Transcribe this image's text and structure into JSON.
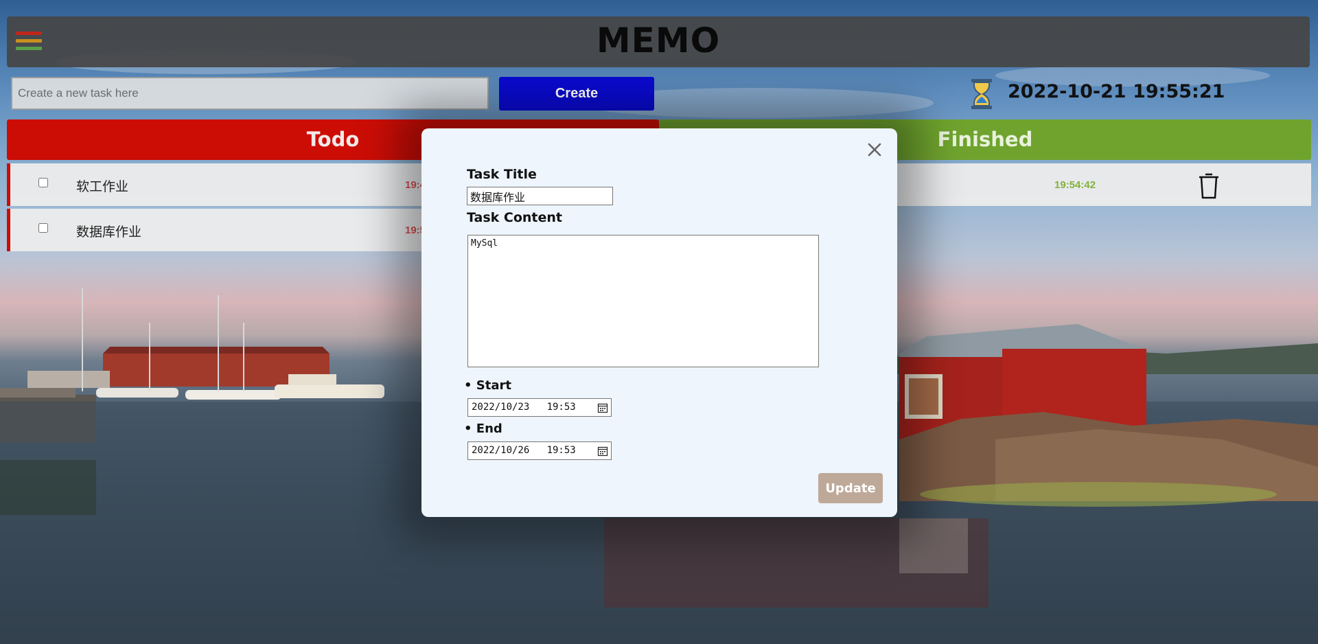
{
  "app": {
    "title": "MEMO"
  },
  "toolbar": {
    "new_task_placeholder": "Create a new task here",
    "create_label": "Create",
    "clock": "2022-10-21 19:55:21"
  },
  "columns": {
    "todo": "Todo",
    "finished": "Finished"
  },
  "todo_items": [
    {
      "name": "软工作业",
      "time": "19:4"
    },
    {
      "name": "数据库作业",
      "time": "19:5"
    }
  ],
  "finished_items": [
    {
      "time": "19:54:42"
    }
  ],
  "modal": {
    "title_label": "Task Title",
    "title_value": "数据库作业",
    "content_label": "Task Content",
    "content_value": "MySql",
    "start_label": "Start",
    "start_value": "2022/10/23   19:53",
    "end_label": "End",
    "end_value": "2022/10/26   19:53",
    "update_label": "Update"
  },
  "colors": {
    "todo": "#cc0d06",
    "finished": "#6fa32e",
    "create": "#0a0ad0",
    "update": "#bea999",
    "menu_bars": [
      "#c0261a",
      "#c8901e",
      "#5aa04a"
    ]
  },
  "icons": [
    "menu-icon",
    "hourglass-icon",
    "trash-icon",
    "close-icon",
    "calendar-icon"
  ]
}
